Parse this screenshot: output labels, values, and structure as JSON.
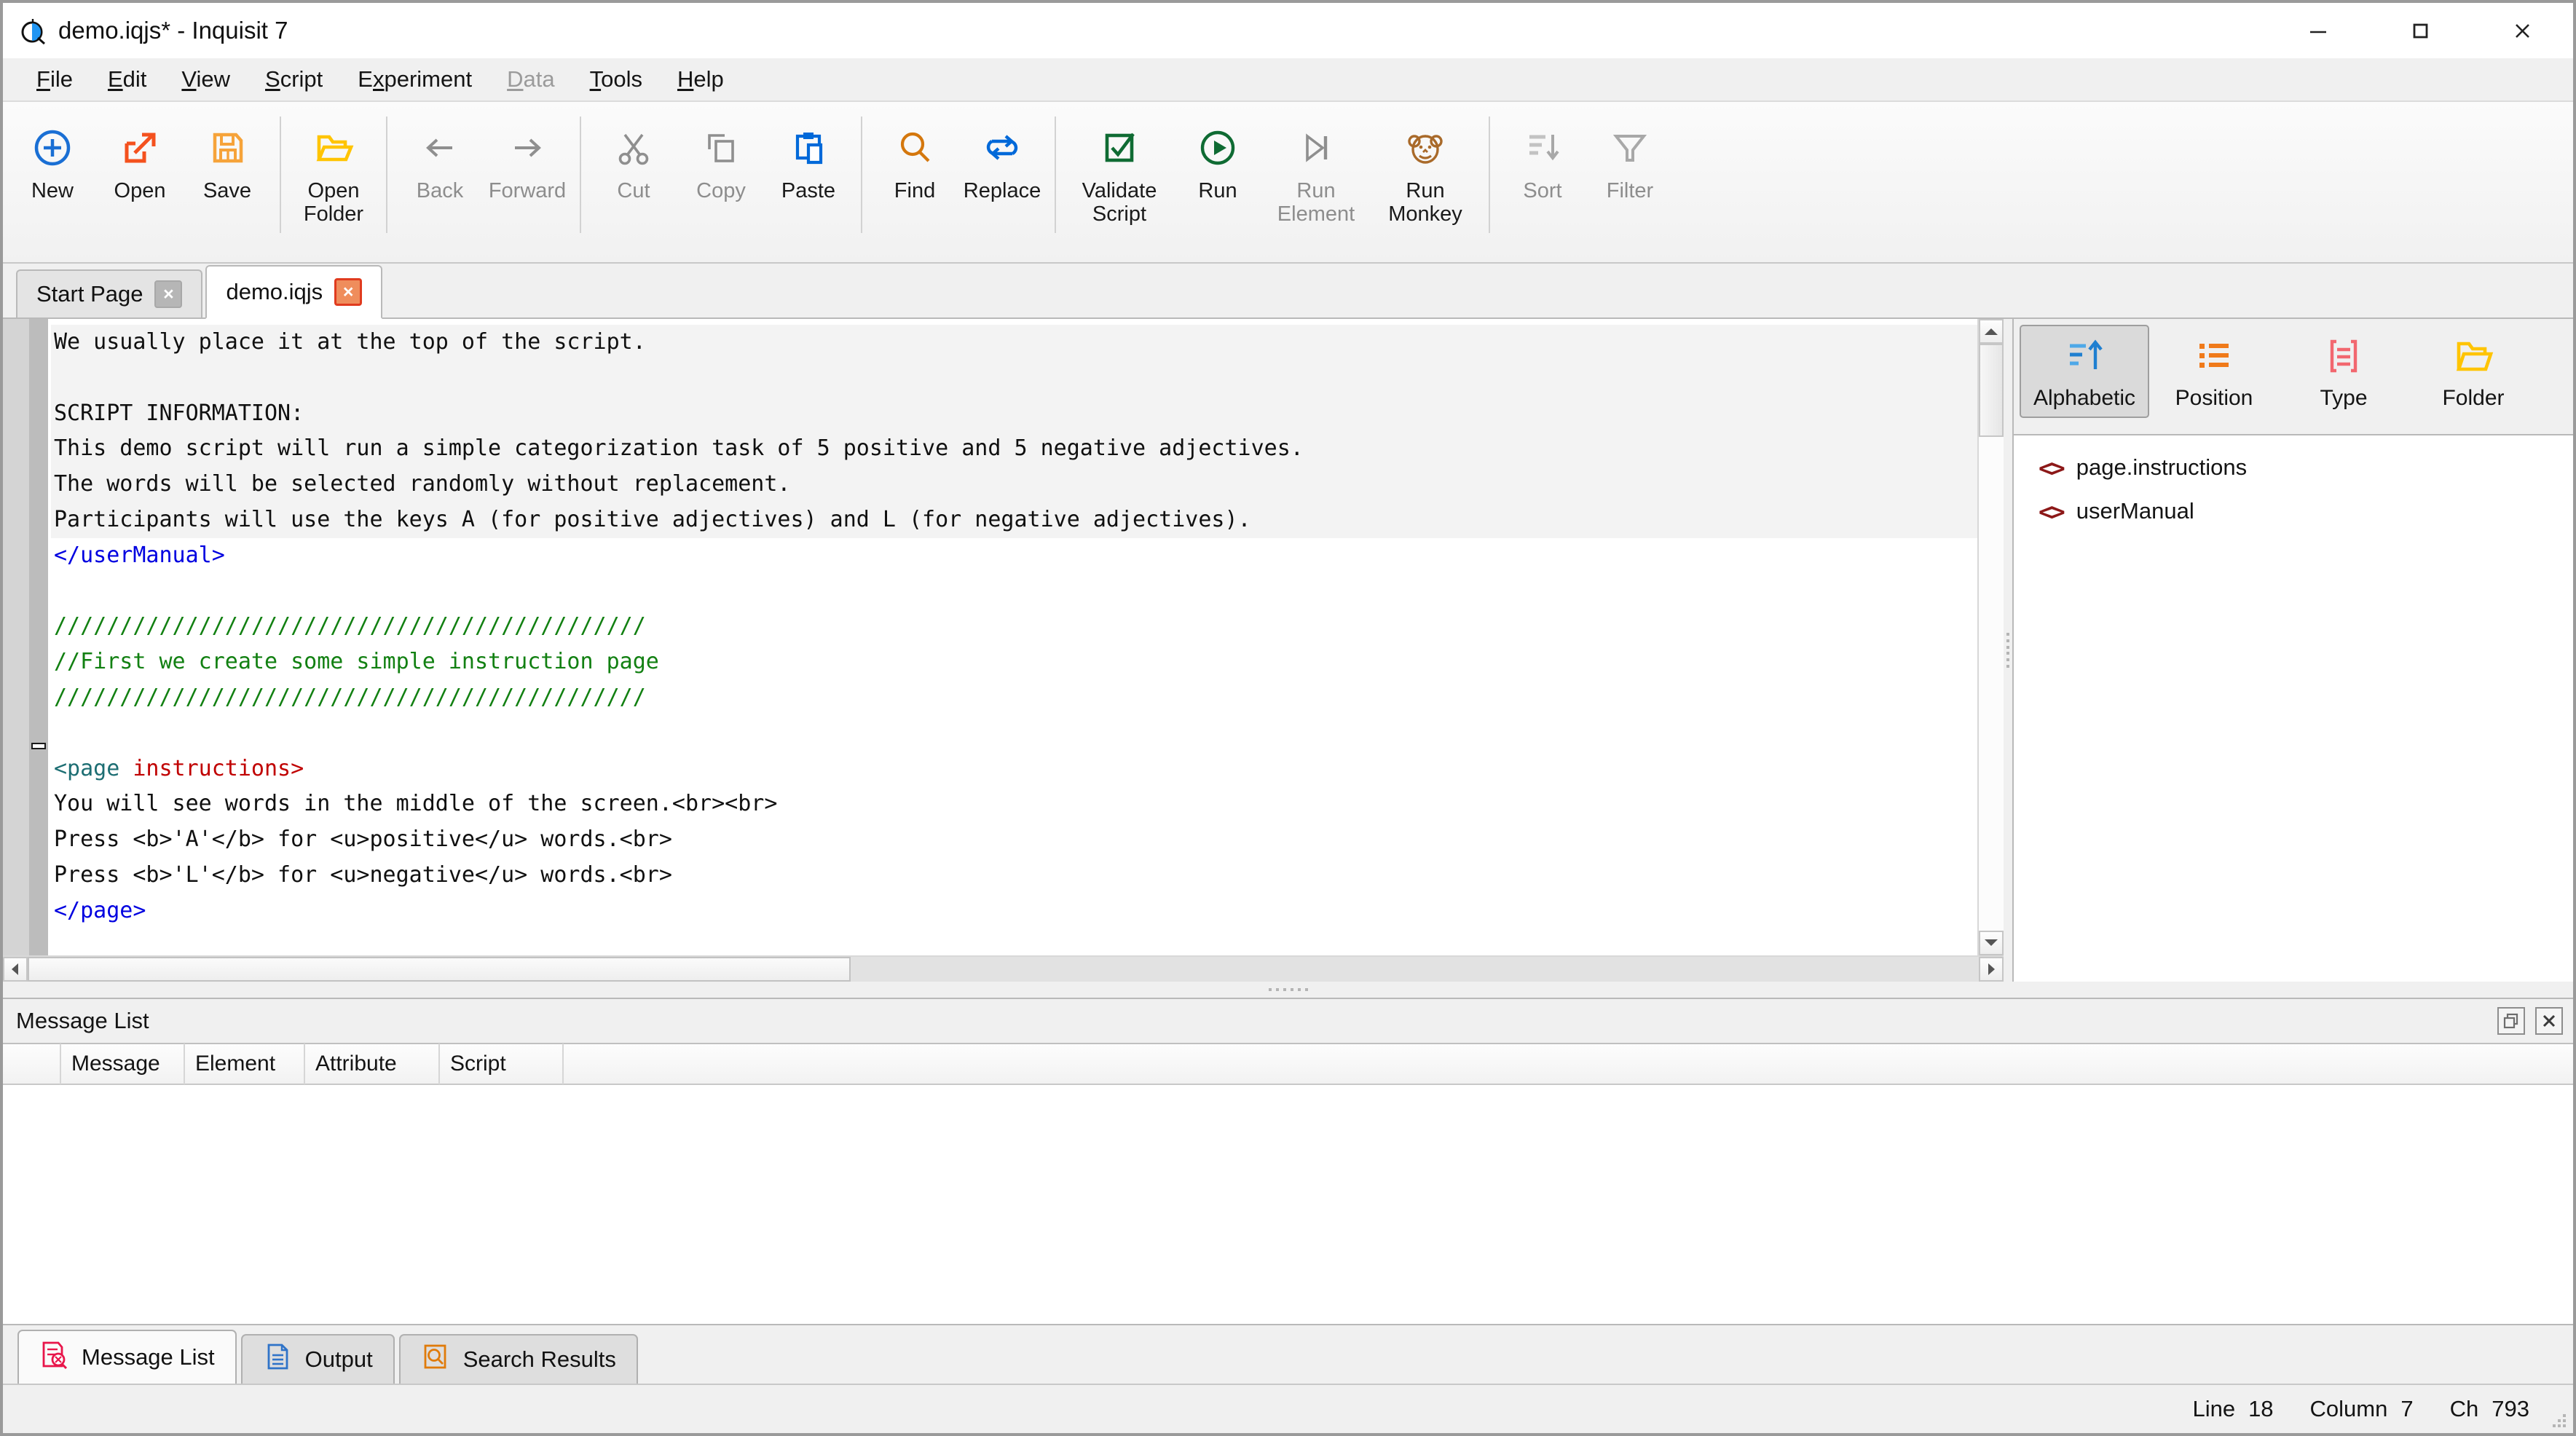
{
  "window": {
    "title": "demo.iqjs* - Inquisit 7",
    "logo_name": "inquisit-logo",
    "minimize_label": "—",
    "maximize_label": "□",
    "close_label": "✕"
  },
  "menubar": {
    "items": [
      {
        "label": "File",
        "accel": "F",
        "disabled": false
      },
      {
        "label": "Edit",
        "accel": "E",
        "disabled": false
      },
      {
        "label": "View",
        "accel": "V",
        "disabled": false
      },
      {
        "label": "Script",
        "accel": "S",
        "disabled": false
      },
      {
        "label": "Experiment",
        "accel": "x",
        "disabled": false
      },
      {
        "label": "Data",
        "accel": "D",
        "disabled": true
      },
      {
        "label": "Tools",
        "accel": "T",
        "disabled": false
      },
      {
        "label": "Help",
        "accel": "H",
        "disabled": false
      }
    ]
  },
  "toolbar": {
    "groups": [
      {
        "buttons": [
          {
            "label": "New",
            "icon": "new-circle-plus-icon",
            "disabled": false
          },
          {
            "label": "Open",
            "icon": "open-arrow-icon",
            "disabled": false
          },
          {
            "label": "Save",
            "icon": "save-floppy-icon",
            "disabled": false
          }
        ]
      },
      {
        "buttons": [
          {
            "label": "Open\nFolder",
            "icon": "open-folder-icon",
            "disabled": false
          }
        ]
      },
      {
        "buttons": [
          {
            "label": "Back",
            "icon": "arrow-left-icon",
            "disabled": true
          },
          {
            "label": "Forward",
            "icon": "arrow-right-icon",
            "disabled": true
          }
        ]
      },
      {
        "buttons": [
          {
            "label": "Cut",
            "icon": "scissors-icon",
            "disabled": true
          },
          {
            "label": "Copy",
            "icon": "copy-icon",
            "disabled": true
          },
          {
            "label": "Paste",
            "icon": "paste-icon",
            "disabled": false
          }
        ]
      },
      {
        "buttons": [
          {
            "label": "Find",
            "icon": "magnifier-icon",
            "disabled": false
          },
          {
            "label": "Replace",
            "icon": "replace-arrows-icon",
            "disabled": false
          }
        ]
      },
      {
        "buttons": [
          {
            "label": "Validate\nScript",
            "icon": "check-box-icon",
            "disabled": false
          },
          {
            "label": "Run",
            "icon": "play-circle-icon",
            "disabled": false
          },
          {
            "label": "Run\nElement",
            "icon": "play-to-end-icon",
            "disabled": true
          },
          {
            "label": "Run\nMonkey",
            "icon": "monkey-face-icon",
            "disabled": false
          }
        ]
      },
      {
        "buttons": [
          {
            "label": "Sort",
            "icon": "sort-descending-icon",
            "disabled": true
          },
          {
            "label": "Filter",
            "icon": "funnel-icon",
            "disabled": true
          }
        ]
      }
    ]
  },
  "tabs": [
    {
      "label": "Start Page",
      "active": false,
      "close_label": "×"
    },
    {
      "label": "demo.iqjs",
      "active": true,
      "close_label": "×"
    }
  ],
  "editor": {
    "lines": [
      {
        "highlight": true,
        "segments": [
          {
            "text": "We usually place it at the top of the script.",
            "cls": "c-plain"
          }
        ]
      },
      {
        "highlight": true,
        "segments": [
          {
            "text": "",
            "cls": "c-plain"
          }
        ]
      },
      {
        "highlight": true,
        "segments": [
          {
            "text": "SCRIPT INFORMATION:",
            "cls": "c-plain"
          }
        ]
      },
      {
        "highlight": true,
        "segments": [
          {
            "text": "This demo script will run a simple categorization task of 5 positive and 5 negative adjectives.",
            "cls": "c-plain"
          }
        ]
      },
      {
        "highlight": true,
        "segments": [
          {
            "text": "The words will be selected randomly without replacement.",
            "cls": "c-plain"
          }
        ]
      },
      {
        "highlight": true,
        "segments": [
          {
            "text": "Participants will use the keys A (for positive adjectives) and L (for negative adjectives).",
            "cls": "c-plain"
          }
        ]
      },
      {
        "highlight": false,
        "segments": [
          {
            "text": "</userManual>",
            "cls": "c-tag"
          }
        ]
      },
      {
        "highlight": false,
        "segments": [
          {
            "text": "",
            "cls": "c-plain"
          }
        ]
      },
      {
        "highlight": false,
        "segments": [
          {
            "text": "/////////////////////////////////////////////",
            "cls": "c-com"
          }
        ]
      },
      {
        "highlight": false,
        "segments": [
          {
            "text": "//First we create some simple instruction page",
            "cls": "c-com"
          }
        ]
      },
      {
        "highlight": false,
        "segments": [
          {
            "text": "/////////////////////////////////////////////",
            "cls": "c-com"
          }
        ]
      },
      {
        "highlight": false,
        "segments": [
          {
            "text": "",
            "cls": "c-plain"
          }
        ]
      },
      {
        "highlight": false,
        "segments": [
          {
            "text": "<page ",
            "cls": "c-page"
          },
          {
            "text": "instructions>",
            "cls": "c-name"
          }
        ]
      },
      {
        "highlight": false,
        "segments": [
          {
            "text": "You will see words in the middle of the screen.<br><br>",
            "cls": "c-plain"
          }
        ]
      },
      {
        "highlight": false,
        "segments": [
          {
            "text": "Press <b>'A'</b> for <u>positive</u> words.<br>",
            "cls": "c-plain"
          }
        ]
      },
      {
        "highlight": false,
        "segments": [
          {
            "text": "Press <b>'L'</b> for <u>negative</u> words.<br>",
            "cls": "c-plain"
          }
        ]
      },
      {
        "highlight": false,
        "segments": [
          {
            "text": "</page>",
            "cls": "c-tag"
          }
        ]
      }
    ]
  },
  "explorer": {
    "view_buttons": [
      {
        "label": "Alphabetic",
        "icon": "sort-alpha-up-icon",
        "selected": true
      },
      {
        "label": "Position",
        "icon": "bullet-list-icon",
        "selected": false
      },
      {
        "label": "Type",
        "icon": "document-type-icon",
        "selected": false
      },
      {
        "label": "Folder",
        "icon": "folder-icon",
        "selected": false
      }
    ],
    "items": [
      {
        "label": "page.instructions",
        "icon": "code-brackets-icon"
      },
      {
        "label": "userManual",
        "icon": "code-brackets-icon"
      }
    ]
  },
  "message_list": {
    "title": "Message List",
    "float_button_label": "float-panel",
    "close_button_label": "✕",
    "columns": [
      "",
      "Message",
      "Element",
      "Attribute",
      "Script"
    ],
    "rows": []
  },
  "bottom_tabs": [
    {
      "label": "Message List",
      "icon": "message-list-icon",
      "active": true
    },
    {
      "label": "Output",
      "icon": "output-doc-icon",
      "active": false
    },
    {
      "label": "Search Results",
      "icon": "search-results-icon",
      "active": false
    }
  ],
  "statusbar": {
    "line_label": "Line",
    "line_value": "18",
    "column_label": "Column",
    "column_value": "7",
    "ch_label": "Ch",
    "ch_value": "793"
  },
  "colors": {
    "accent_blue": "#1a6fd4",
    "orange": "#ef6c00",
    "yellow": "#ffc400",
    "green": "#0f7b32",
    "red": "#c00000",
    "brown": "#a96a2a"
  }
}
